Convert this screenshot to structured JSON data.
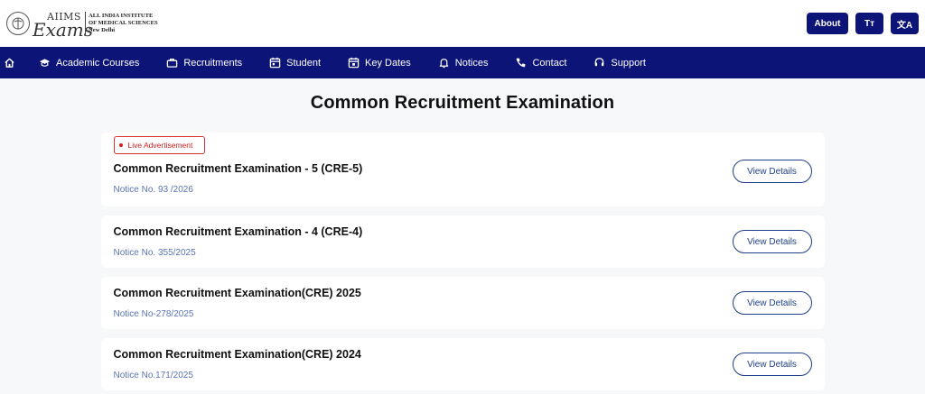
{
  "brand": {
    "script_top": "AIIMS",
    "script_bottom": "Exams",
    "line1": "All India Institute",
    "line2": "of Medical Sciences",
    "city": "New Delhi"
  },
  "header": {
    "about_label": "About",
    "text_size_label": "Tт",
    "translate_label": "文A"
  },
  "nav": {
    "items": [
      {
        "label": "Academic Courses",
        "icon": "graduation-cap-icon"
      },
      {
        "label": "Recruitments",
        "icon": "briefcase-icon"
      },
      {
        "label": "Student",
        "icon": "calendar-icon"
      },
      {
        "label": "Key Dates",
        "icon": "calendar-check-icon"
      },
      {
        "label": "Notices",
        "icon": "bell-icon"
      },
      {
        "label": "Contact",
        "icon": "phone-icon"
      },
      {
        "label": "Support",
        "icon": "headset-icon"
      }
    ]
  },
  "page": {
    "title": "Common Recruitment Examination"
  },
  "exams": [
    {
      "badge": "Live Advertisement",
      "title": "Common Recruitment Examination - 5 (CRE-5)",
      "notice": "Notice No. 93 /2026",
      "button": "View Details"
    },
    {
      "title": "Common Recruitment Examination - 4 (CRE-4)",
      "notice": "Notice No. 355/2025",
      "button": "View Details"
    },
    {
      "title": "Common Recruitment Examination(CRE) 2025",
      "notice": "Notice No-278/2025",
      "button": "View Details"
    },
    {
      "title": "Common Recruitment Examination(CRE) 2024",
      "notice": "Notice No.171/2025",
      "button": "View Details"
    }
  ],
  "colors": {
    "primary": "#0c1478",
    "live": "#d02020",
    "notice": "#5a74b6"
  }
}
